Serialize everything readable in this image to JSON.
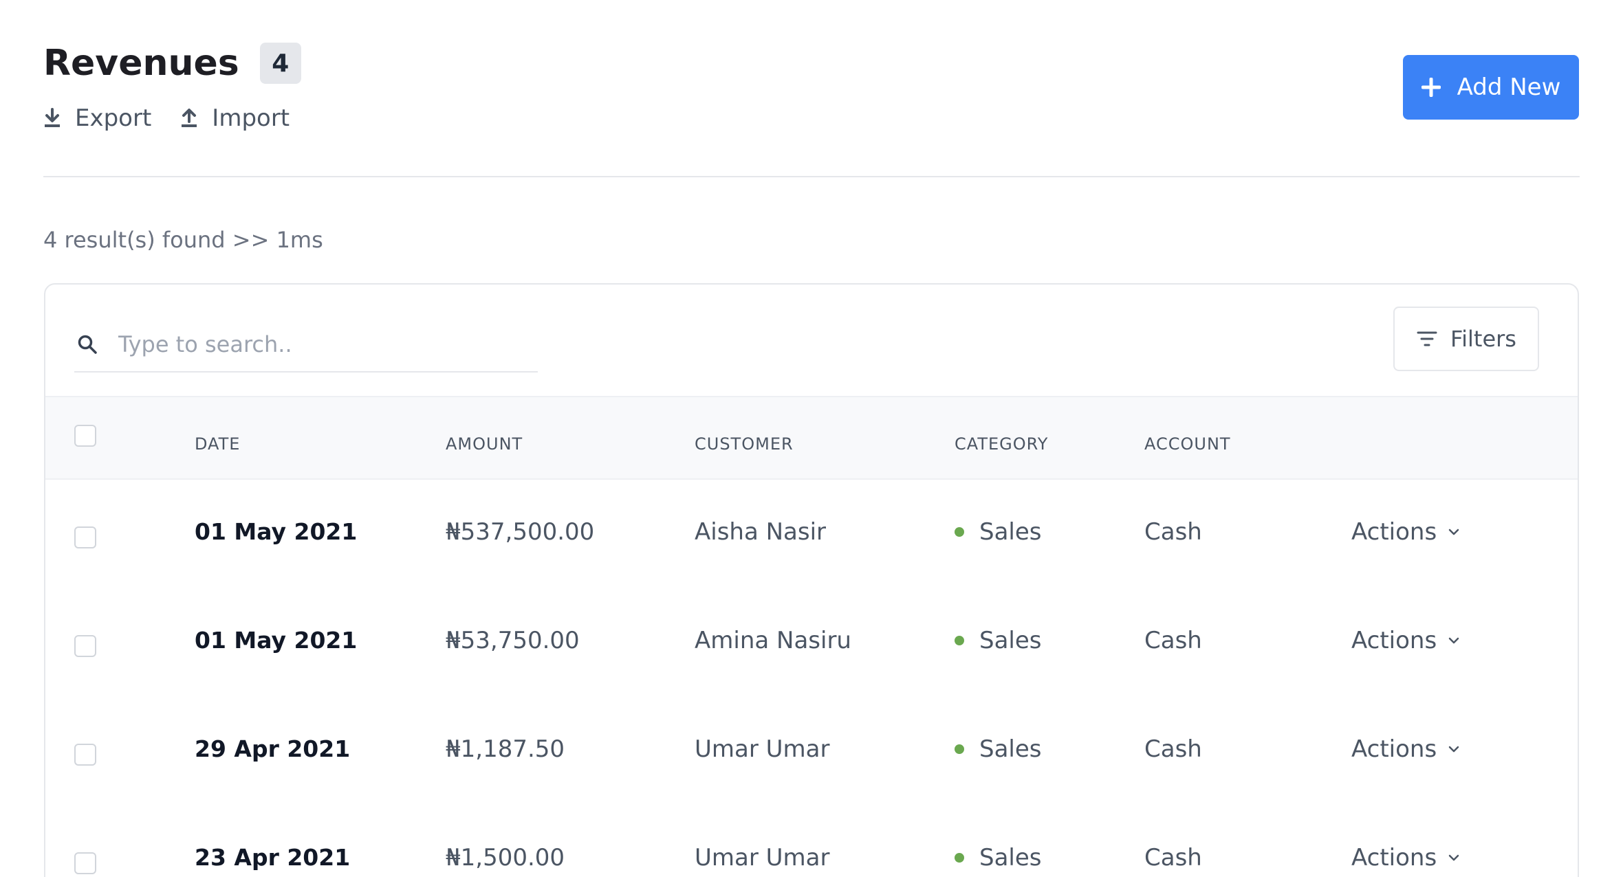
{
  "header": {
    "title": "Revenues",
    "count": "4",
    "export_label": "Export",
    "import_label": "Import",
    "add_label": "Add New"
  },
  "results_text": "4 result(s) found >> 1ms",
  "search": {
    "placeholder": "Type to search.."
  },
  "filters_label": "Filters",
  "columns": {
    "date": "DATE",
    "amount": "AMOUNT",
    "customer": "CUSTOMER",
    "category": "CATEGORY",
    "account": "ACCOUNT"
  },
  "rows": [
    {
      "date": "01 May 2021",
      "amount": "₦537,500.00",
      "customer": "Aisha Nasir",
      "category": "Sales",
      "account": "Cash",
      "actions": "Actions"
    },
    {
      "date": "01 May 2021",
      "amount": "₦53,750.00",
      "customer": "Amina Nasiru",
      "category": "Sales",
      "account": "Cash",
      "actions": "Actions"
    },
    {
      "date": "29 Apr 2021",
      "amount": "₦1,187.50",
      "customer": "Umar Umar",
      "category": "Sales",
      "account": "Cash",
      "actions": "Actions"
    },
    {
      "date": "23 Apr 2021",
      "amount": "₦1,500.00",
      "customer": "Umar Umar",
      "category": "Sales",
      "account": "Cash",
      "actions": "Actions"
    }
  ],
  "colors": {
    "accent": "#3b82f6",
    "category_dot": "#6aa84f"
  }
}
